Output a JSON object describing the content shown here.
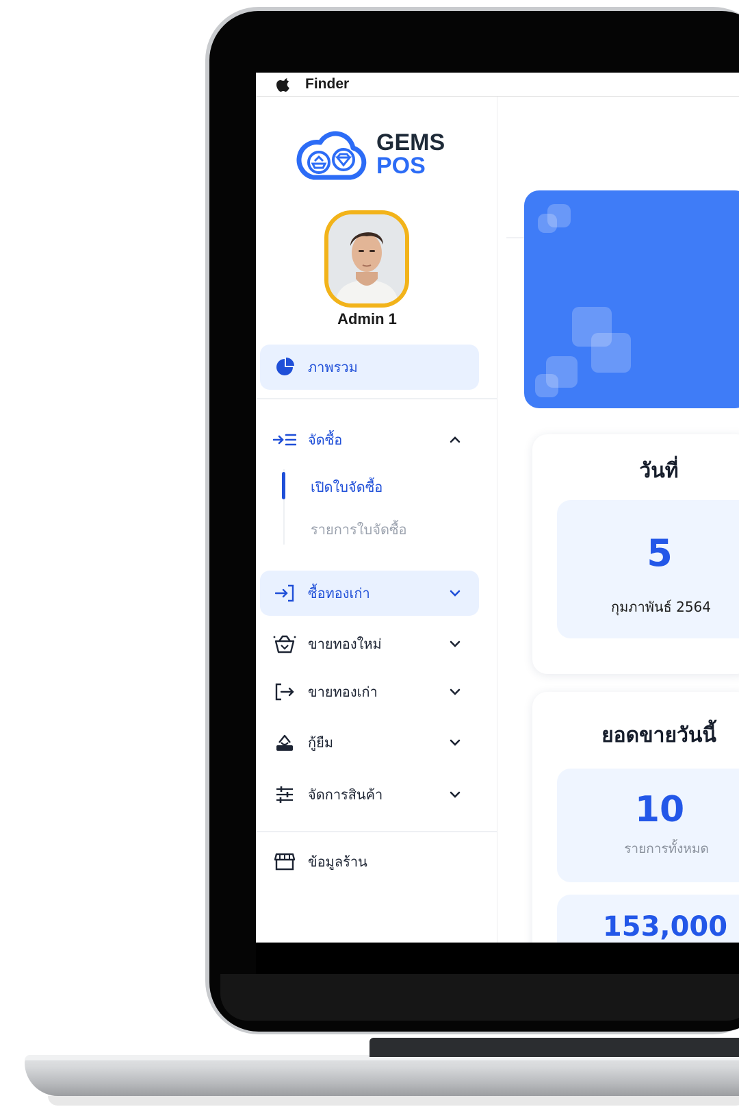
{
  "menubar": {
    "app_name": "Finder"
  },
  "brand": {
    "line1": "GEMS",
    "line2": "POS"
  },
  "user": {
    "name": "Admin 1"
  },
  "sidebar": {
    "overview": "ภาพรวม",
    "purchase": {
      "label": "จัดซื้อ",
      "children": [
        "เปิดใบจัดซื้อ",
        "รายการใบจัดซื้อ"
      ]
    },
    "items": [
      {
        "label": "ซื้อทองเก่า",
        "icon": "login-arrow-icon"
      },
      {
        "label": "ขายทองใหม่",
        "icon": "gold-basket-icon"
      },
      {
        "label": "ขายทองเก่า",
        "icon": "logout-arrow-icon"
      },
      {
        "label": "กู้ยืม",
        "icon": "pawn-icon"
      },
      {
        "label": "จัดการสินค้า",
        "icon": "sliders-icon"
      }
    ],
    "shop_info": "ข้อมูลร้าน"
  },
  "date_card": {
    "title": "วันที่",
    "day": "5",
    "month_year": "กุมภาพันธ์ 2564"
  },
  "sales_card": {
    "title": "ยอดขายวันนี้",
    "count": "10",
    "count_caption": "รายการทั้งหมด",
    "amount": "153,000"
  },
  "colors": {
    "accent": "#2c6cf6",
    "hero": "#3f7cf7",
    "avatar_ring": "#f2b31a",
    "active_bg": "#e9f1ff"
  }
}
